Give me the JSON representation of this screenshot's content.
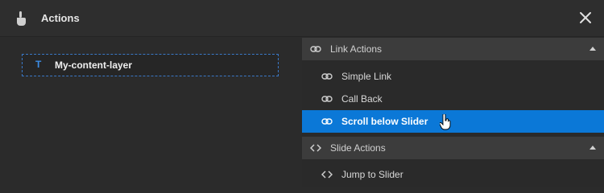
{
  "window": {
    "title": "Actions",
    "title_icon": "hand-pointer-icon",
    "close_icon": "close-icon"
  },
  "layer": {
    "icon_text": "T",
    "label": "My-content-layer"
  },
  "groups": [
    {
      "label": "Link Actions",
      "icon": "link-icon",
      "expanded": true,
      "items": [
        {
          "label": "Simple Link",
          "icon": "link-icon",
          "selected": false
        },
        {
          "label": "Call Back",
          "icon": "link-icon",
          "selected": false
        },
        {
          "label": "Scroll below Slider",
          "icon": "link-icon",
          "selected": true
        }
      ]
    },
    {
      "label": "Slide Actions",
      "icon": "code-icon",
      "expanded": true,
      "items": [
        {
          "label": "Jump to Slider",
          "icon": "code-icon",
          "selected": false
        }
      ]
    }
  ],
  "colors": {
    "accent": "#0b78d7",
    "layer_border": "#3a78c6"
  }
}
